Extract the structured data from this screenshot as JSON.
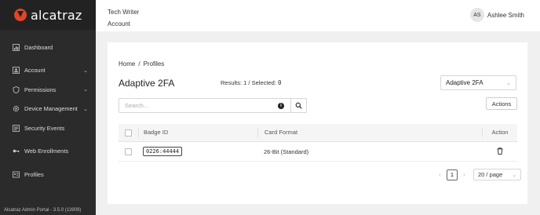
{
  "brand": {
    "name": "alcatraz",
    "accent": "#e0452a"
  },
  "sidebar": {
    "items": [
      {
        "label": "Dashboard",
        "icon": "bar-chart-icon",
        "expandable": false
      },
      {
        "label": "Account",
        "icon": "account-icon",
        "expandable": true
      },
      {
        "label": "Permissions",
        "icon": "shield-icon",
        "expandable": true
      },
      {
        "label": "Device Management",
        "icon": "gear-icon",
        "expandable": true
      },
      {
        "label": "Security Events",
        "icon": "list-icon",
        "expandable": false
      },
      {
        "label": "Web Enrollments",
        "icon": "key-icon",
        "expandable": false
      },
      {
        "label": "Profiles",
        "icon": "id-card-icon",
        "expandable": false
      }
    ],
    "footer": "Alcatraz Admin Portal - 3.5.0 (13909)"
  },
  "header": {
    "org_name": "Tech Writer",
    "section": "Account",
    "user_initials": "AS",
    "user_name": "Ashlee Smith"
  },
  "breadcrumb": {
    "home": "Home",
    "separator": "/",
    "current": "Profiles"
  },
  "page": {
    "title": "Adaptive 2FA",
    "results_label": "Results: 1 / Selected: ",
    "selected_count": "0",
    "profile_select_value": "Adaptive 2FA",
    "search_placeholder": "Search...",
    "actions_label": "Actions"
  },
  "table": {
    "columns": [
      "Badge ID",
      "Card Format",
      "Action"
    ],
    "rows": [
      {
        "badge_id": "0226:44444",
        "card_format": "26-Bit (Standard)",
        "action_icon": "trash-icon"
      }
    ]
  },
  "pagination": {
    "current_page": "1",
    "page_size": "20 / page"
  }
}
